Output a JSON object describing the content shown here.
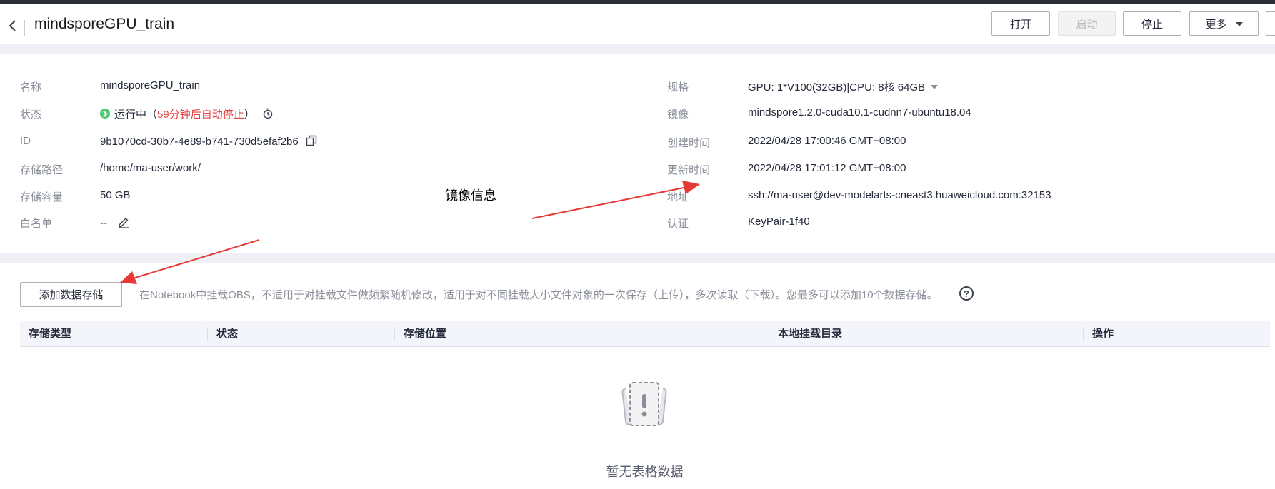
{
  "header": {
    "title": "mindsporeGPU_train",
    "buttons": {
      "open": "打开",
      "start": "启动",
      "stop": "停止",
      "more": "更多"
    }
  },
  "info": {
    "left": {
      "name_label": "名称",
      "name_value": "mindsporeGPU_train",
      "status_label": "状态",
      "status_value": "运行中",
      "status_paren_open": "（",
      "status_auto_stop": "59分钟后自动停止",
      "status_paren_close": "）",
      "id_label": "ID",
      "id_value": "9b1070cd-30b7-4e89-b741-730d5efaf2b6",
      "path_label": "存储路径",
      "path_value": "/home/ma-user/work/",
      "capacity_label": "存储容量",
      "capacity_value": "50 GB",
      "whitelist_label": "白名单",
      "whitelist_value": "--"
    },
    "right": {
      "spec_label": "规格",
      "spec_value": "GPU: 1*V100(32GB)|CPU: 8核 64GB",
      "image_label": "镜像",
      "image_value": "mindspore1.2.0-cuda10.1-cudnn7-ubuntu18.04",
      "created_label": "创建时间",
      "created_value": "2022/04/28 17:00:46 GMT+08:00",
      "updated_label": "更新时间",
      "updated_value": "2022/04/28 17:01:12 GMT+08:00",
      "address_label": "地址",
      "address_value": "ssh://ma-user@dev-modelarts-cneast3.huaweicloud.com:32153",
      "auth_label": "认证",
      "auth_value": "KeyPair-1f40"
    }
  },
  "annotation": "镜像信息",
  "storage": {
    "add_button": "添加数据存储",
    "description": "在Notebook中挂载OBS，不适用于对挂载文件做频繁随机修改，适用于对不同挂载大小文件对象的一次保存（上传），多次读取（下载）。您最多可以添加10个数据存储。",
    "help_icon": "?",
    "columns": [
      "存储类型",
      "状态",
      "存储位置",
      "本地挂载目录",
      "操作"
    ],
    "empty_text": "暂无表格数据"
  },
  "colors": {
    "accent_running": "#50c878",
    "auto_stop": "#e54545",
    "arrow": "#e53935"
  }
}
